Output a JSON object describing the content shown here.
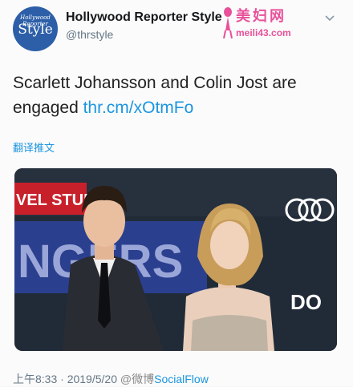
{
  "account": {
    "avatar_text_small": "Hollywood Reporter",
    "avatar_text_large": "Style",
    "name": "Hollywood Reporter Style",
    "handle": "@thrstyle"
  },
  "watermark": {
    "title": "美妇网",
    "url": "meili43.com"
  },
  "tweet": {
    "text": "Scarlett Johansson and Colin Jost are engaged ",
    "link": "thr.cm/xOtmFo"
  },
  "translate_label": "翻译推文",
  "photo": {
    "backdrop_text_1": "VEL STUDIOS",
    "backdrop_text_2": "NGERS",
    "backdrop_text_3": "DO"
  },
  "footer": {
    "time": "上午8:33",
    "separator": " · ",
    "date": "2019/5/20",
    "weibo": "@微博",
    "app": "SocialFlow"
  },
  "colors": {
    "link": "#1b95e0",
    "avatar_bg": "#2d5fa8",
    "watermark": "#e8519a"
  }
}
